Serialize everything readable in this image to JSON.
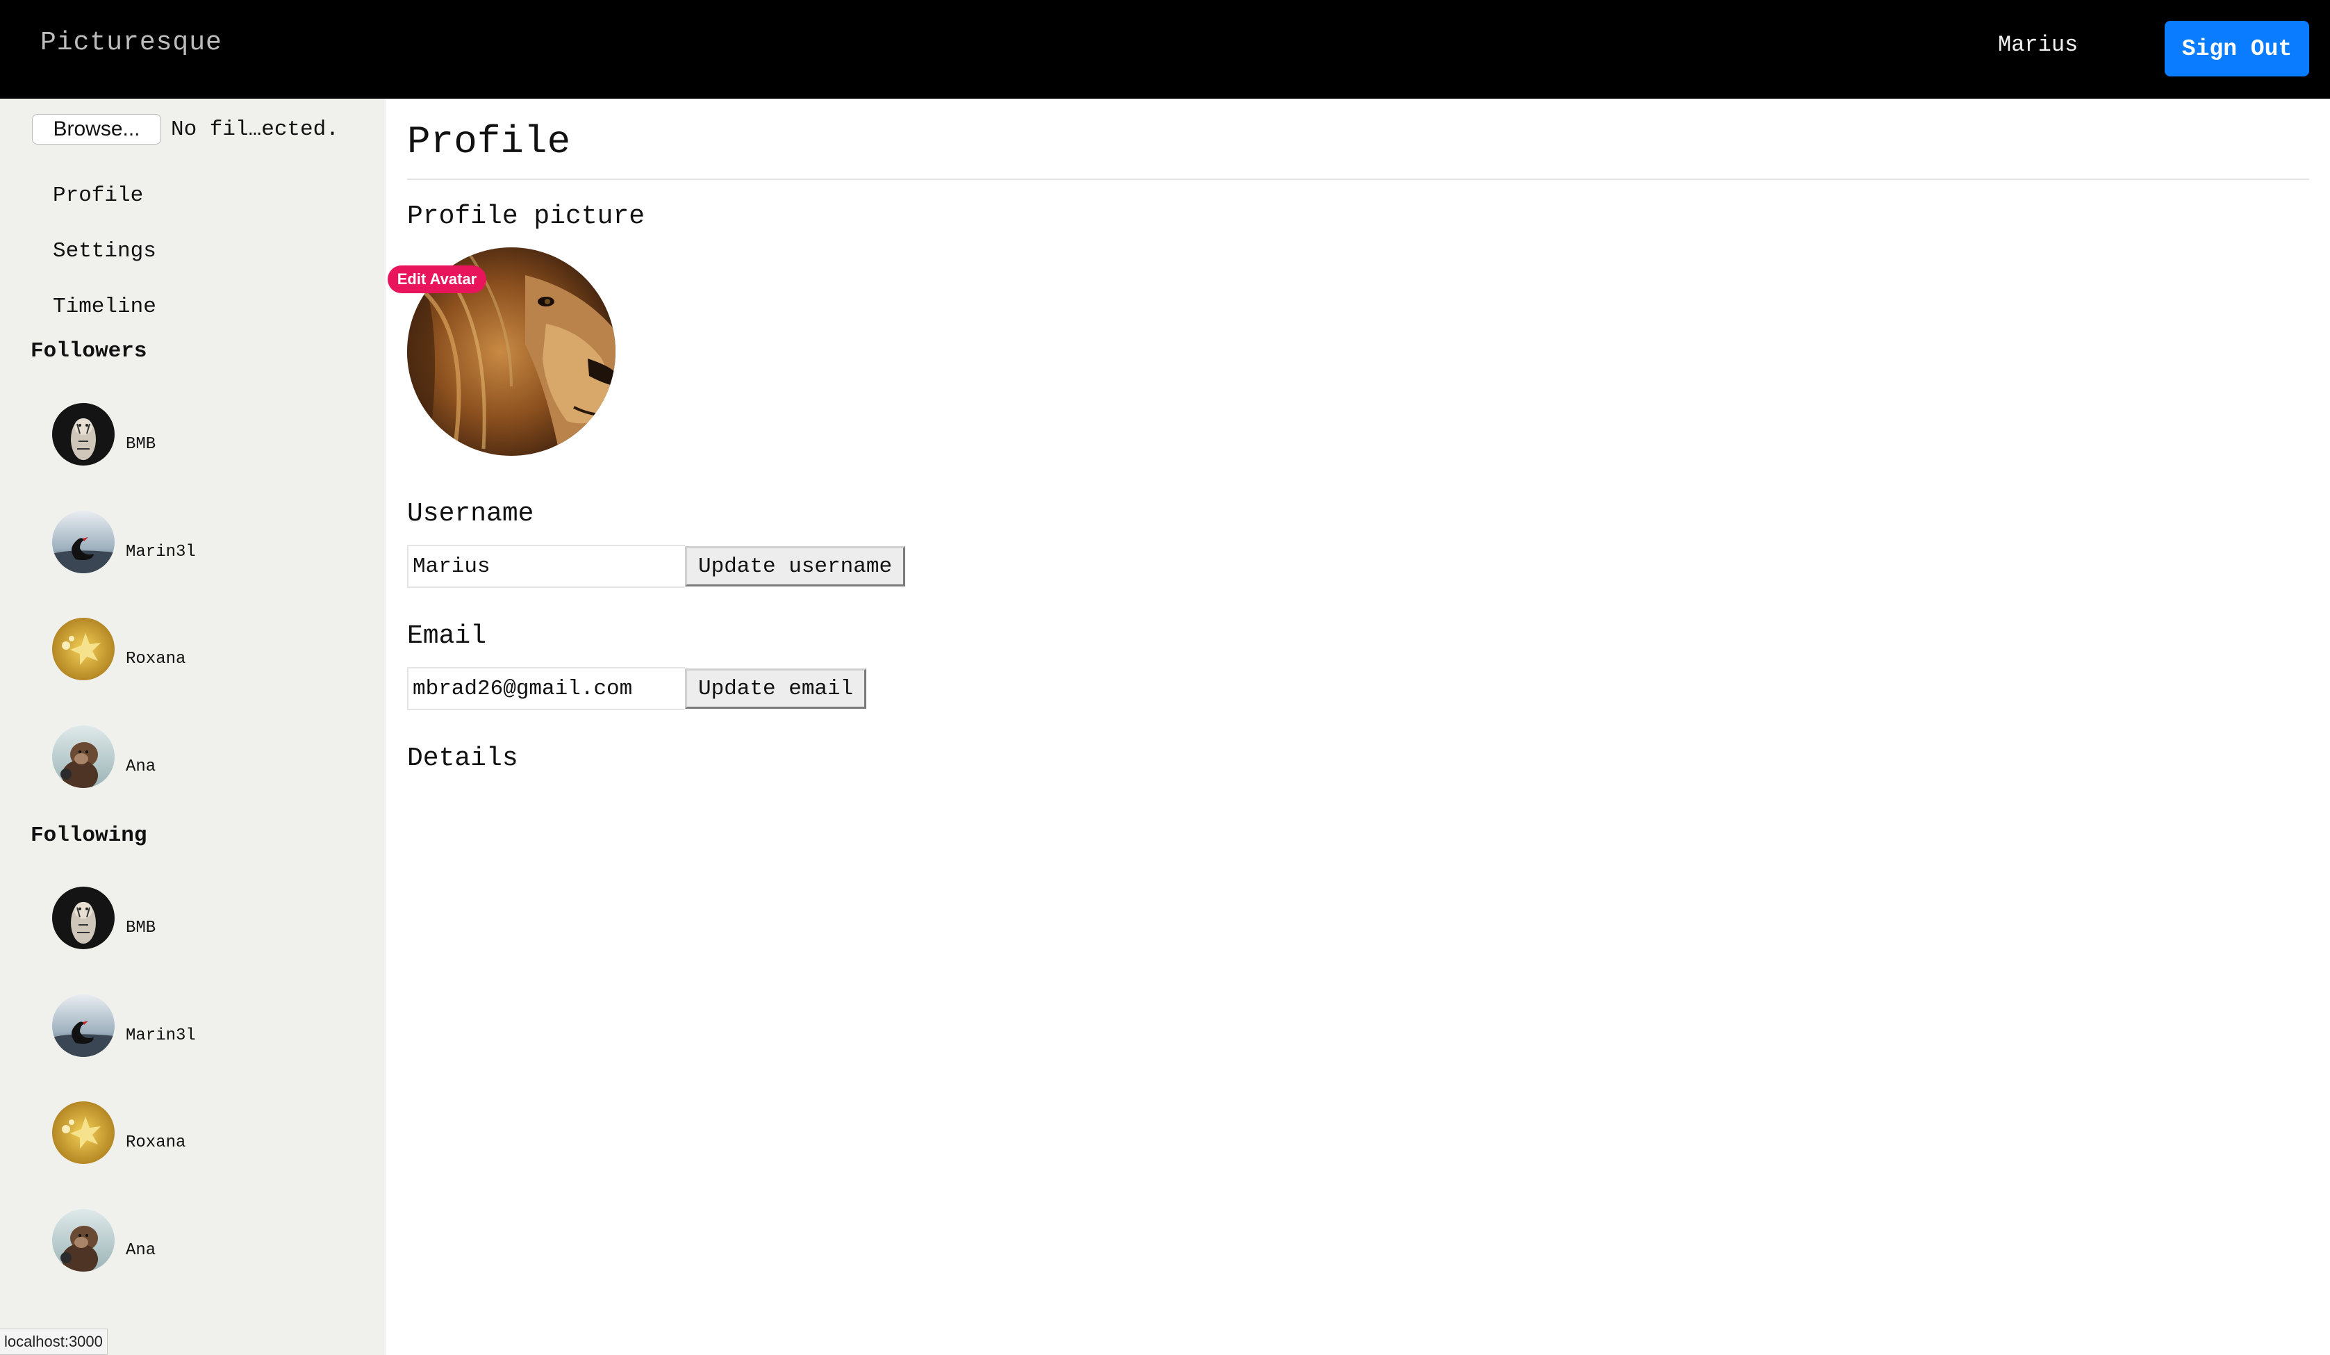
{
  "header": {
    "brand": "Picturesque",
    "user_name": "Marius",
    "sign_out_label": "Sign Out"
  },
  "sidebar": {
    "file_input": {
      "browse_label": "Browse...",
      "status_text": "No fil…ected."
    },
    "nav": [
      {
        "label": "Profile"
      },
      {
        "label": "Settings"
      },
      {
        "label": "Timeline"
      }
    ],
    "followers_heading": "Followers",
    "followers": [
      {
        "name": "BMB",
        "avatar": "tiger-avatar"
      },
      {
        "name": "Marin3l",
        "avatar": "swan-avatar"
      },
      {
        "name": "Roxana",
        "avatar": "golden-avatar"
      },
      {
        "name": "Ana",
        "avatar": "monkey-avatar"
      }
    ],
    "following_heading": "Following",
    "following": [
      {
        "name": "BMB",
        "avatar": "tiger-avatar"
      },
      {
        "name": "Marin3l",
        "avatar": "swan-avatar"
      },
      {
        "name": "Roxana",
        "avatar": "golden-avatar"
      },
      {
        "name": "Ana",
        "avatar": "monkey-avatar"
      }
    ]
  },
  "main": {
    "title": "Profile",
    "profile_picture_heading": "Profile picture",
    "edit_avatar_label": "Edit Avatar",
    "username_heading": "Username",
    "username_value": "Marius",
    "update_username_label": "Update username",
    "email_heading": "Email",
    "email_value": "mbrad26@gmail.com",
    "update_email_label": "Update email",
    "details_heading": "Details"
  },
  "status_bar": {
    "url": "localhost:3000"
  },
  "colors": {
    "topbar": "#000000",
    "sign_out_button": "#0a7cff",
    "sidebar_bg": "#f0f0ec",
    "edit_badge": "#e8155c"
  }
}
